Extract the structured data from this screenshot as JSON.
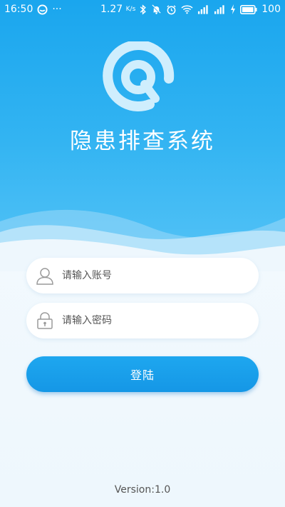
{
  "status_bar": {
    "time": "16:50",
    "more": "···",
    "net_speed": "1.27",
    "net_speed_unit": "K/s",
    "battery": "100",
    "icons": [
      "message-circle-icon",
      "bluetooth-icon",
      "mute-icon",
      "alarm-icon",
      "wifi-icon",
      "signal-icon",
      "signal-4g-icon",
      "charging-icon",
      "battery-icon"
    ]
  },
  "app": {
    "title": "隐患排查系统",
    "logo_icon": "app-logo-icon"
  },
  "form": {
    "account": {
      "placeholder": "请输入账号",
      "value": "",
      "icon": "user-icon"
    },
    "password": {
      "placeholder": "请输入密码",
      "value": "",
      "icon": "lock-icon"
    },
    "login_label": "登陆"
  },
  "footer": {
    "version": "Version:1.0"
  },
  "colors": {
    "primary": "#1aa6ee",
    "button": "#1597e6",
    "background": "#f3f9fd"
  }
}
